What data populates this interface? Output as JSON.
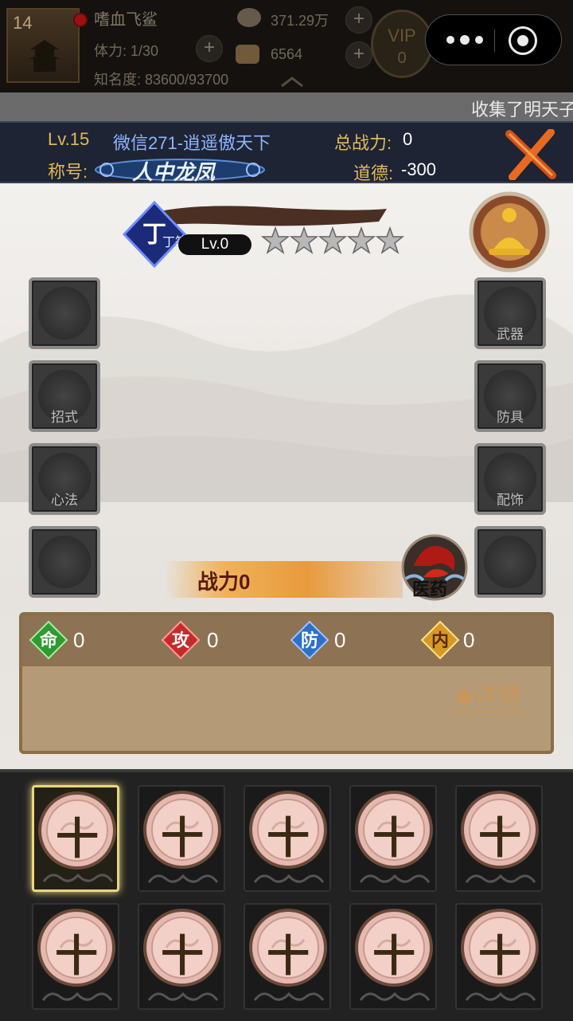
{
  "topbar": {
    "avatar_level": "14",
    "player_name": "嗜血飞鲨",
    "stamina": "体力: 1/30",
    "reputation": "知名度: 83600/93700",
    "silver": "371.29万",
    "gold": "6564",
    "vip_label": "VIP",
    "vip_level": "0"
  },
  "marquee": {
    "text": "收集了明天子"
  },
  "header": {
    "level": "Lv.15",
    "server_name": "微信271-逍遥傲天下",
    "total_power_label": "总战力:",
    "total_power": "0",
    "title_label": "称号:",
    "title_value": "人中龙凤",
    "morality_label": "道德:",
    "morality": "-300"
  },
  "character": {
    "rank": "丁等",
    "level": "Lv.0",
    "stars": 5,
    "power_label": "战力0"
  },
  "slots": {
    "left": [
      "",
      "招式",
      "心法",
      ""
    ],
    "right": [
      "武器",
      "防具",
      "配饰",
      ""
    ]
  },
  "medicine_label": "医药",
  "stats": [
    {
      "icon": "命",
      "value": "0",
      "color": "#2f9a2f"
    },
    {
      "icon": "攻",
      "value": "0",
      "color": "#c52a2a"
    },
    {
      "icon": "防",
      "value": "0",
      "color": "#2f6fc5"
    },
    {
      "icon": "内",
      "value": "0",
      "color": "#d69a24"
    }
  ],
  "detail_link": "◆详情",
  "skill_cards": [
    {
      "glyph": "十",
      "selected": true
    },
    {
      "glyph": "十"
    },
    {
      "glyph": "十"
    },
    {
      "glyph": "十"
    },
    {
      "glyph": "十"
    },
    {
      "glyph": "十"
    },
    {
      "glyph": "十"
    },
    {
      "glyph": "十"
    },
    {
      "glyph": "十"
    },
    {
      "glyph": "十"
    }
  ]
}
